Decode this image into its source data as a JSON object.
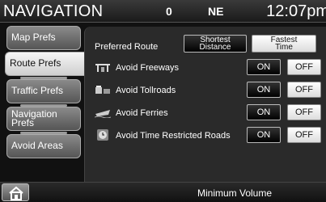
{
  "header": {
    "title": "NAVIGATION",
    "signal_indicator": "0",
    "compass": "NE",
    "clock": "12:07pm"
  },
  "tabs": [
    {
      "label": "Map Prefs",
      "active": false
    },
    {
      "label": "Route Prefs",
      "active": true
    },
    {
      "label": "Traffic Prefs",
      "active": false
    },
    {
      "label": "Navigation Prefs",
      "active": false
    },
    {
      "label": "Avoid Areas",
      "active": false
    }
  ],
  "preferred_route": {
    "label": "Preferred Route",
    "shortest_distance": "Shortest Distance",
    "fastest_time": "Fastest Time",
    "selected": "fastest_time"
  },
  "options": [
    {
      "label": "Avoid Freeways",
      "icon": "freeway-icon",
      "on": "ON",
      "off": "OFF",
      "selected": "off"
    },
    {
      "label": "Avoid Tollroads",
      "icon": "tollroad-icon",
      "on": "ON",
      "off": "OFF",
      "selected": "off"
    },
    {
      "label": "Avoid Ferries",
      "icon": "ferry-icon",
      "on": "ON",
      "off": "OFF",
      "selected": "off"
    },
    {
      "label": "Avoid Time Restricted Roads",
      "icon": "time-restricted-icon",
      "on": "ON",
      "off": "OFF",
      "selected": "off"
    }
  ],
  "bottom_bar": {
    "home_icon": "home-icon",
    "status": "Minimum Volume"
  }
}
